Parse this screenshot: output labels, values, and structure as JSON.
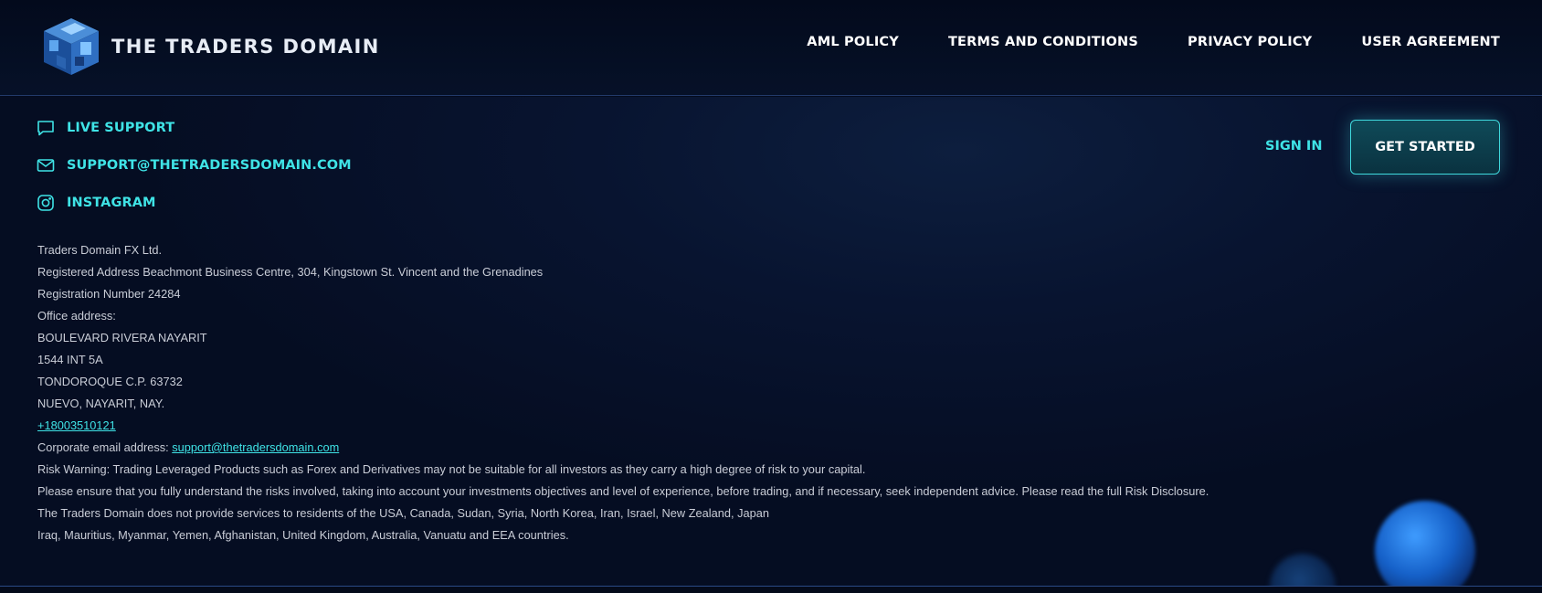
{
  "header": {
    "logo_text": "THE TRADERS DOMAIN",
    "nav": [
      "AML POLICY",
      "TERMS AND CONDITIONS",
      "PRIVACY POLICY",
      "USER AGREEMENT"
    ]
  },
  "contacts": {
    "live_support": "LIVE SUPPORT",
    "email": "SUPPORT@THETRADERSDOMAIN.COM",
    "instagram": "INSTAGRAM"
  },
  "auth": {
    "sign_in": "SIGN IN",
    "get_started": "GET STARTED"
  },
  "company": {
    "name": "Traders Domain FX Ltd.",
    "registered_address": "Registered Address Beachmont Business Centre, 304, Kingstown St. Vincent and the Grenadines",
    "registration_number": "Registration Number 24284",
    "office_label": "Office address:",
    "office_line1": "BOULEVARD RIVERA NAYARIT",
    "office_line2": "1544 INT 5A",
    "office_line3": "TONDOROQUE C.P. 63732",
    "office_line4": "NUEVO, NAYARIT, NAY.",
    "phone": "+18003510121",
    "corporate_email_label": "Corporate email address:",
    "corporate_email": "support@thetradersdomain.com",
    "risk_warning": "Risk Warning: Trading Leveraged Products such as Forex and Derivatives may not be suitable for all investors as they carry a high degree of risk to your capital.",
    "risk_ensure": "Please ensure that you fully understand the risks involved, taking into account your investments objectives and level of experience, before trading, and if necessary, seek independent advice. Please read the full Risk Disclosure.",
    "restriction_line1": "The Traders Domain does not provide services to residents of the USA, Canada, Sudan, Syria, North Korea, Iran, Israel, New Zealand, Japan",
    "restriction_line2": "Iraq, Mauritius, Myanmar, Yemen, Afghanistan, United Kingdom, Australia, Vanuatu and EEA countries."
  },
  "colors": {
    "accent": "#3fe3e6",
    "background": "#040b1e",
    "text": "#c9cdd7"
  },
  "icons": [
    "cube-logo-icon",
    "chat-bubble-icon",
    "mail-icon",
    "instagram-icon"
  ]
}
